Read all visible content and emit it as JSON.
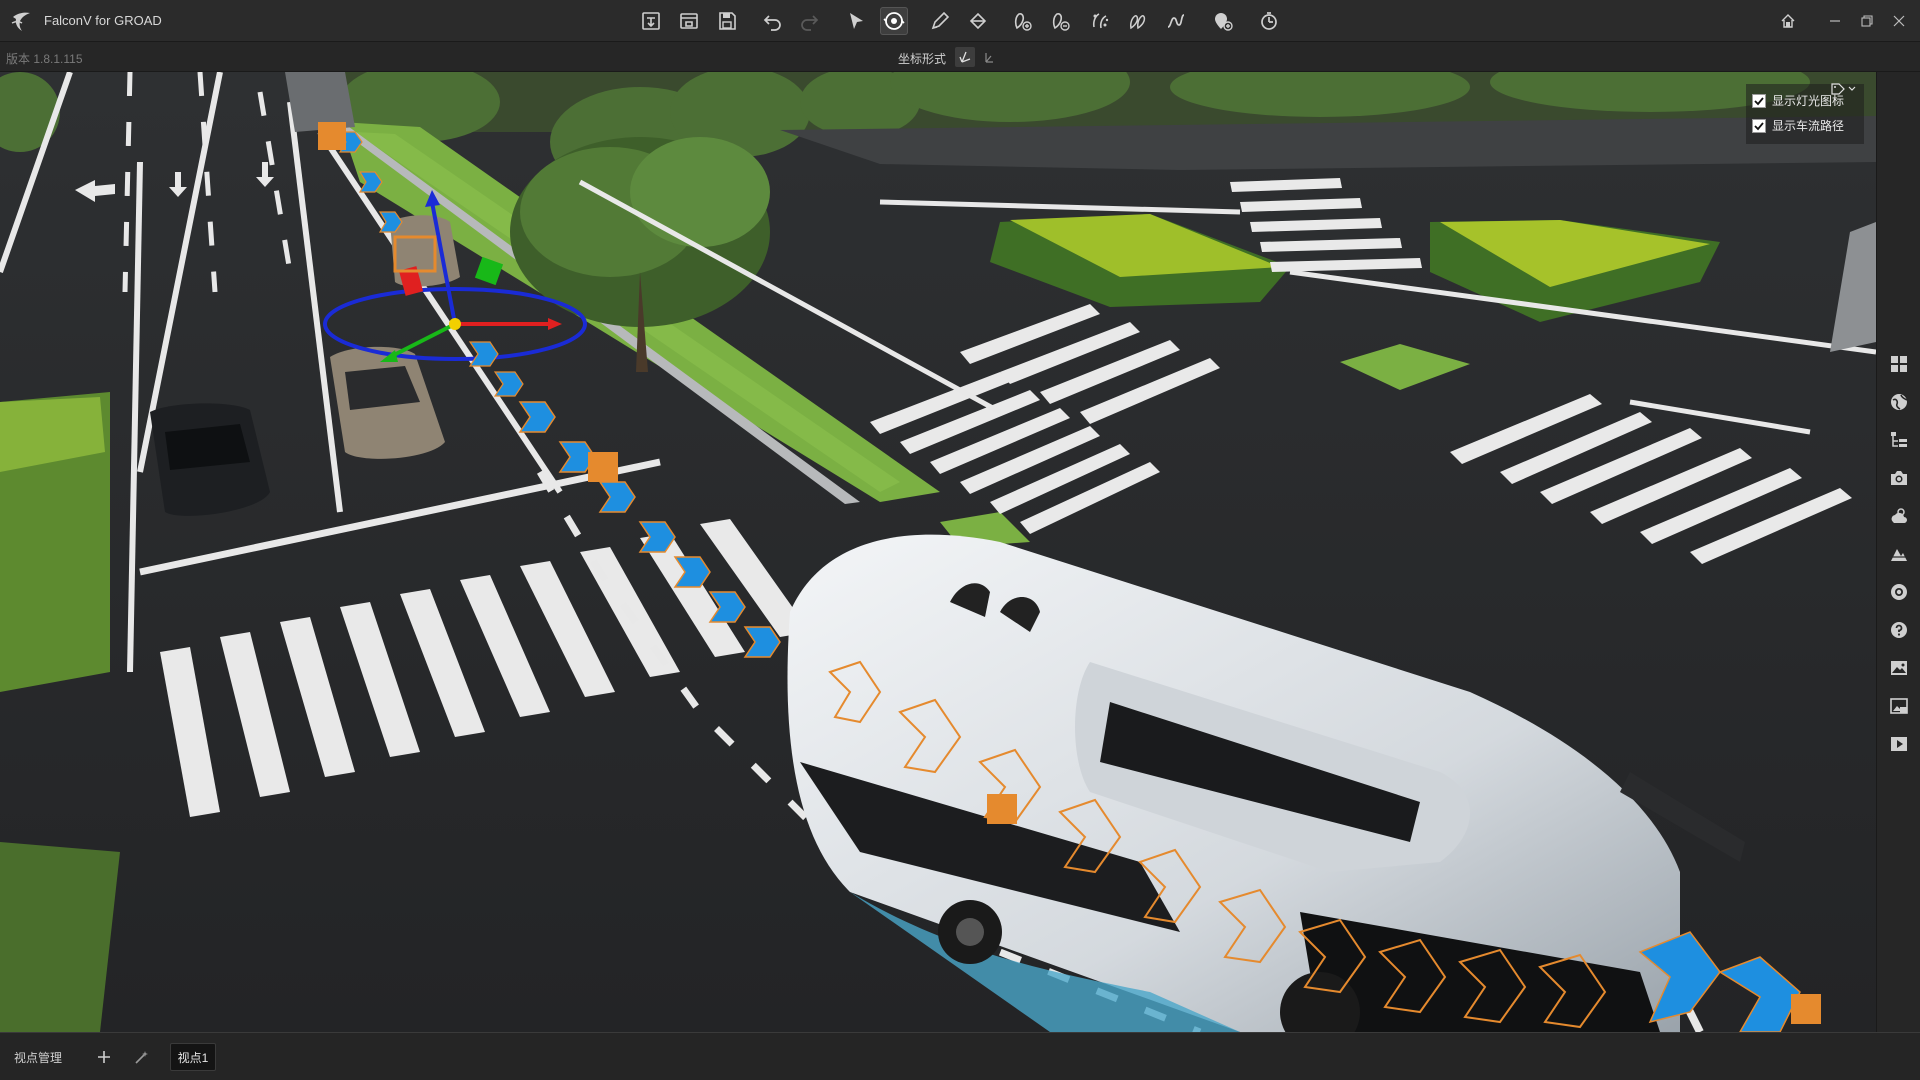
{
  "app": {
    "title": "FalconV for GROAD",
    "version": "版本 1.8.1.115"
  },
  "toolbar": {
    "items": [
      {
        "name": "import-button",
        "icon": "import-icon"
      },
      {
        "name": "open-button",
        "icon": "open-icon"
      },
      {
        "name": "save-button",
        "icon": "save-icon"
      },
      {
        "name": "undo-button",
        "icon": "undo-icon"
      },
      {
        "name": "redo-button",
        "icon": "redo-icon",
        "disabled": true
      },
      {
        "name": "select-button",
        "icon": "cursor-icon"
      },
      {
        "name": "orbit-button",
        "icon": "orbit-icon",
        "active": true
      },
      {
        "name": "pen-button",
        "icon": "pen-icon"
      },
      {
        "name": "fill-button",
        "icon": "paint-bucket-icon"
      },
      {
        "name": "add-vehicle-button",
        "icon": "add-vehicle-icon"
      },
      {
        "name": "remove-vehicle-button",
        "icon": "remove-vehicle-icon"
      },
      {
        "name": "scatter-button",
        "icon": "scatter-icon"
      },
      {
        "name": "people-button",
        "icon": "people-icon"
      },
      {
        "name": "route-button",
        "icon": "route-icon"
      },
      {
        "name": "add-marker-button",
        "icon": "add-marker-icon"
      },
      {
        "name": "timer-button",
        "icon": "timer-icon"
      }
    ]
  },
  "subbar": {
    "coord_label": "坐标形式"
  },
  "overlay": {
    "show_light_icon": {
      "label": "显示灯光图标",
      "checked": true
    },
    "show_traffic_path": {
      "label": "显示车流路径",
      "checked": true
    }
  },
  "right_toolbar": {
    "items": [
      "grid-icon",
      "globe-icon",
      "tree-list-icon",
      "camera-icon",
      "weather-icon",
      "terrain-icon",
      "settings-icon",
      "help-icon",
      "image-icon",
      "screenshot-icon",
      "play-icon"
    ]
  },
  "bottom": {
    "viewpoint_management": "视点管理",
    "viewpoint_tab": "视点1"
  },
  "colors": {
    "accent_orange": "#e58a2e",
    "path_blue": "#1e8fe0",
    "gizmo_blue": "#1a2bd6",
    "gizmo_red": "#e02020",
    "gizmo_green": "#18b818"
  }
}
